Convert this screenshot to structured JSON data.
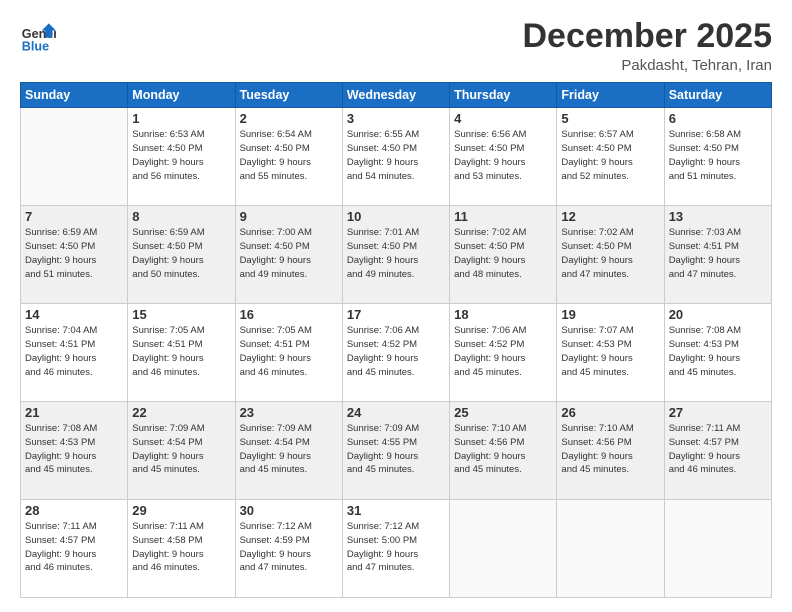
{
  "header": {
    "logo_line1": "General",
    "logo_line2": "Blue",
    "month": "December 2025",
    "location": "Pakdasht, Tehran, Iran"
  },
  "weekdays": [
    "Sunday",
    "Monday",
    "Tuesday",
    "Wednesday",
    "Thursday",
    "Friday",
    "Saturday"
  ],
  "weeks": [
    [
      {
        "day": "",
        "info": ""
      },
      {
        "day": "1",
        "info": "Sunrise: 6:53 AM\nSunset: 4:50 PM\nDaylight: 9 hours\nand 56 minutes."
      },
      {
        "day": "2",
        "info": "Sunrise: 6:54 AM\nSunset: 4:50 PM\nDaylight: 9 hours\nand 55 minutes."
      },
      {
        "day": "3",
        "info": "Sunrise: 6:55 AM\nSunset: 4:50 PM\nDaylight: 9 hours\nand 54 minutes."
      },
      {
        "day": "4",
        "info": "Sunrise: 6:56 AM\nSunset: 4:50 PM\nDaylight: 9 hours\nand 53 minutes."
      },
      {
        "day": "5",
        "info": "Sunrise: 6:57 AM\nSunset: 4:50 PM\nDaylight: 9 hours\nand 52 minutes."
      },
      {
        "day": "6",
        "info": "Sunrise: 6:58 AM\nSunset: 4:50 PM\nDaylight: 9 hours\nand 51 minutes."
      }
    ],
    [
      {
        "day": "7",
        "info": "Sunrise: 6:59 AM\nSunset: 4:50 PM\nDaylight: 9 hours\nand 51 minutes."
      },
      {
        "day": "8",
        "info": "Sunrise: 6:59 AM\nSunset: 4:50 PM\nDaylight: 9 hours\nand 50 minutes."
      },
      {
        "day": "9",
        "info": "Sunrise: 7:00 AM\nSunset: 4:50 PM\nDaylight: 9 hours\nand 49 minutes."
      },
      {
        "day": "10",
        "info": "Sunrise: 7:01 AM\nSunset: 4:50 PM\nDaylight: 9 hours\nand 49 minutes."
      },
      {
        "day": "11",
        "info": "Sunrise: 7:02 AM\nSunset: 4:50 PM\nDaylight: 9 hours\nand 48 minutes."
      },
      {
        "day": "12",
        "info": "Sunrise: 7:02 AM\nSunset: 4:50 PM\nDaylight: 9 hours\nand 47 minutes."
      },
      {
        "day": "13",
        "info": "Sunrise: 7:03 AM\nSunset: 4:51 PM\nDaylight: 9 hours\nand 47 minutes."
      }
    ],
    [
      {
        "day": "14",
        "info": "Sunrise: 7:04 AM\nSunset: 4:51 PM\nDaylight: 9 hours\nand 46 minutes."
      },
      {
        "day": "15",
        "info": "Sunrise: 7:05 AM\nSunset: 4:51 PM\nDaylight: 9 hours\nand 46 minutes."
      },
      {
        "day": "16",
        "info": "Sunrise: 7:05 AM\nSunset: 4:51 PM\nDaylight: 9 hours\nand 46 minutes."
      },
      {
        "day": "17",
        "info": "Sunrise: 7:06 AM\nSunset: 4:52 PM\nDaylight: 9 hours\nand 45 minutes."
      },
      {
        "day": "18",
        "info": "Sunrise: 7:06 AM\nSunset: 4:52 PM\nDaylight: 9 hours\nand 45 minutes."
      },
      {
        "day": "19",
        "info": "Sunrise: 7:07 AM\nSunset: 4:53 PM\nDaylight: 9 hours\nand 45 minutes."
      },
      {
        "day": "20",
        "info": "Sunrise: 7:08 AM\nSunset: 4:53 PM\nDaylight: 9 hours\nand 45 minutes."
      }
    ],
    [
      {
        "day": "21",
        "info": "Sunrise: 7:08 AM\nSunset: 4:53 PM\nDaylight: 9 hours\nand 45 minutes."
      },
      {
        "day": "22",
        "info": "Sunrise: 7:09 AM\nSunset: 4:54 PM\nDaylight: 9 hours\nand 45 minutes."
      },
      {
        "day": "23",
        "info": "Sunrise: 7:09 AM\nSunset: 4:54 PM\nDaylight: 9 hours\nand 45 minutes."
      },
      {
        "day": "24",
        "info": "Sunrise: 7:09 AM\nSunset: 4:55 PM\nDaylight: 9 hours\nand 45 minutes."
      },
      {
        "day": "25",
        "info": "Sunrise: 7:10 AM\nSunset: 4:56 PM\nDaylight: 9 hours\nand 45 minutes."
      },
      {
        "day": "26",
        "info": "Sunrise: 7:10 AM\nSunset: 4:56 PM\nDaylight: 9 hours\nand 45 minutes."
      },
      {
        "day": "27",
        "info": "Sunrise: 7:11 AM\nSunset: 4:57 PM\nDaylight: 9 hours\nand 46 minutes."
      }
    ],
    [
      {
        "day": "28",
        "info": "Sunrise: 7:11 AM\nSunset: 4:57 PM\nDaylight: 9 hours\nand 46 minutes."
      },
      {
        "day": "29",
        "info": "Sunrise: 7:11 AM\nSunset: 4:58 PM\nDaylight: 9 hours\nand 46 minutes."
      },
      {
        "day": "30",
        "info": "Sunrise: 7:12 AM\nSunset: 4:59 PM\nDaylight: 9 hours\nand 47 minutes."
      },
      {
        "day": "31",
        "info": "Sunrise: 7:12 AM\nSunset: 5:00 PM\nDaylight: 9 hours\nand 47 minutes."
      },
      {
        "day": "",
        "info": ""
      },
      {
        "day": "",
        "info": ""
      },
      {
        "day": "",
        "info": ""
      }
    ]
  ]
}
